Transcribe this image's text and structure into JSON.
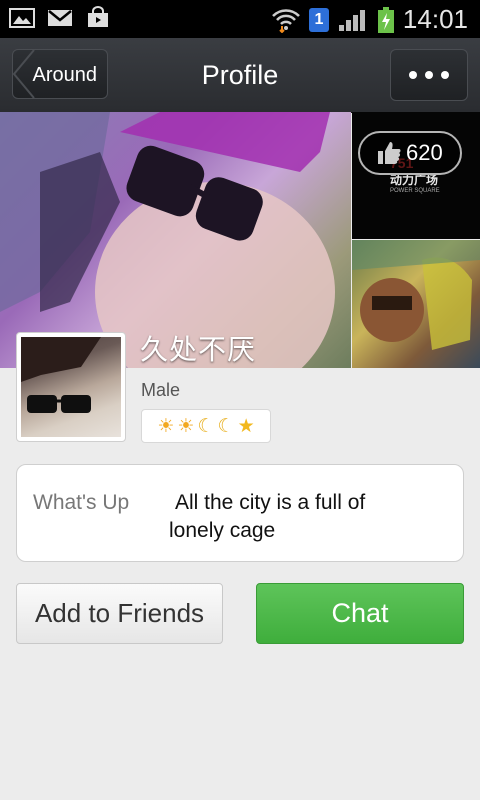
{
  "status_bar": {
    "time": "14:01",
    "sim_label": "1",
    "icons": [
      "gallery-icon",
      "gmail-icon",
      "store-icon",
      "wifi-icon",
      "sim-icon",
      "signal-icon",
      "battery-charging-icon"
    ]
  },
  "header": {
    "back_label": "Around",
    "title": "Profile",
    "more_icon": "more-dots-icon"
  },
  "gallery": {
    "likes_count": "620",
    "like_icon": "thumbs-up-icon"
  },
  "profile": {
    "name": "久处不厌",
    "gender": "Male",
    "level_icons": [
      "sun",
      "sun",
      "moon",
      "moon",
      "star"
    ]
  },
  "whats_up": {
    "label": "What's Up",
    "line1": "All the city is a full of",
    "line2": "lonely cage"
  },
  "actions": {
    "add_label": "Add to Friends",
    "chat_label": "Chat"
  },
  "colors": {
    "chat_green": "#4cb847",
    "titlebar_dark": "#2f3236"
  }
}
